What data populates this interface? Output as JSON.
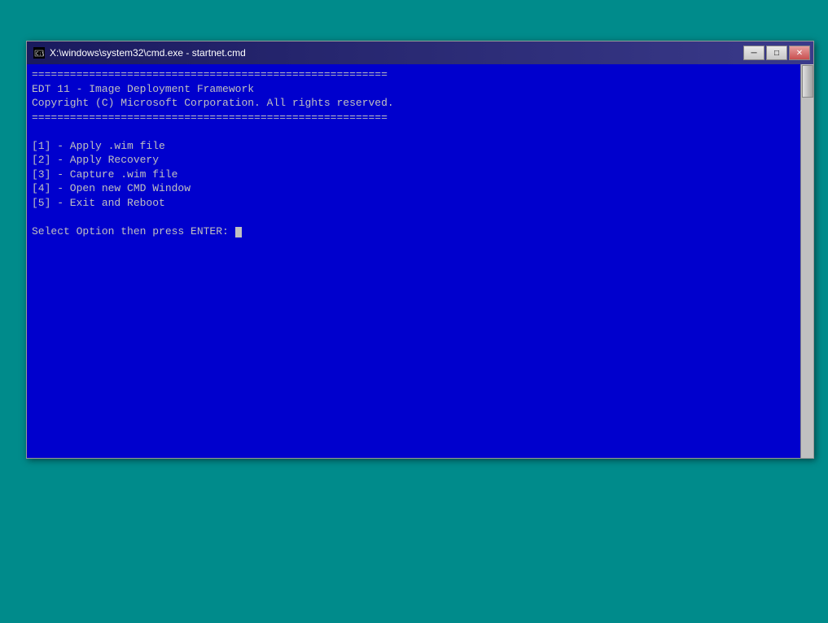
{
  "window": {
    "title": "X:\\windows\\system32\\cmd.exe - startnet.cmd",
    "title_icon": "cmd-icon"
  },
  "titlebar": {
    "minimize_label": "─",
    "restore_label": "□",
    "close_label": "✕"
  },
  "console": {
    "separator": "========================================================",
    "line1": "EDT 11 - Image Deployment Framework",
    "line2": "Copyright (C) Microsoft Corporation. All rights reserved.",
    "separator2": "========================================================",
    "blank1": "",
    "menu1": "[1] - Apply .wim file",
    "menu2": "[2] - Apply Recovery",
    "menu3": "[3] - Capture .wim file",
    "menu4": "[4] - Open new CMD Window",
    "menu5": "[5] - Exit and Reboot",
    "blank2": "",
    "prompt": "Select Option then press ENTER: "
  },
  "colors": {
    "background": "#008B8B",
    "console_bg": "#0000CD",
    "title_bar_start": "#1a1a5e",
    "title_bar_end": "#3a3a8a",
    "text_color": "#c0c0c0"
  }
}
